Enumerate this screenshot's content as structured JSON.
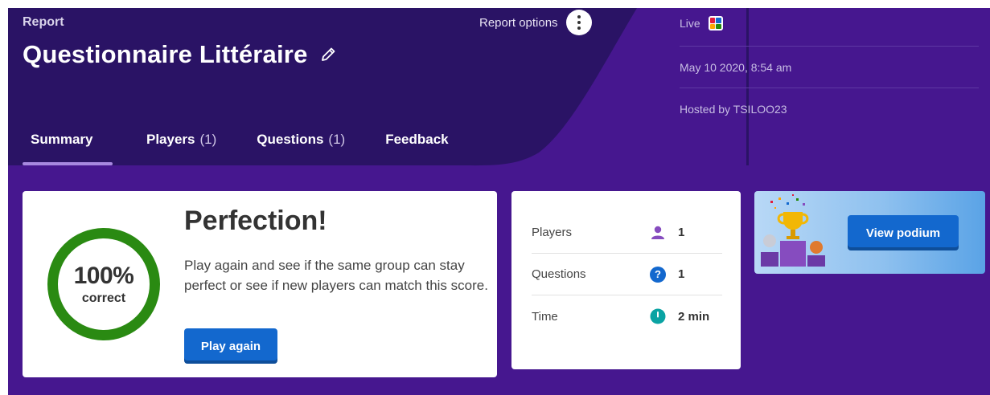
{
  "header": {
    "section_label": "Report",
    "title": "Questionnaire Littéraire",
    "report_options_label": "Report options"
  },
  "tabs": [
    {
      "label": "Summary",
      "count": ""
    },
    {
      "label": "Players",
      "count": "(1)"
    },
    {
      "label": "Questions",
      "count": "(1)"
    },
    {
      "label": "Feedback",
      "count": ""
    }
  ],
  "info": {
    "mode": "Live",
    "date": "May 10 2020, 8:54 am",
    "host": "Hosted by TSILOO23"
  },
  "result": {
    "percent_text": "100%",
    "percent_value": 100,
    "percent_caption": "correct",
    "heading": "Perfection!",
    "message": "Play again and see if the same group can stay perfect or see if new players can match this score.",
    "play_again_label": "Play again"
  },
  "stats": [
    {
      "label": "Players",
      "value": "1",
      "icon": "player-icon"
    },
    {
      "label": "Questions",
      "value": "1",
      "icon": "question-icon"
    },
    {
      "label": "Time",
      "value": "2 min",
      "icon": "clock-icon"
    }
  ],
  "podium": {
    "button_label": "View podium"
  },
  "colors": {
    "background": "#46178f",
    "header": "#2a1365",
    "accent_blue": "#1368ce",
    "ring_green": "#2a8a12"
  }
}
